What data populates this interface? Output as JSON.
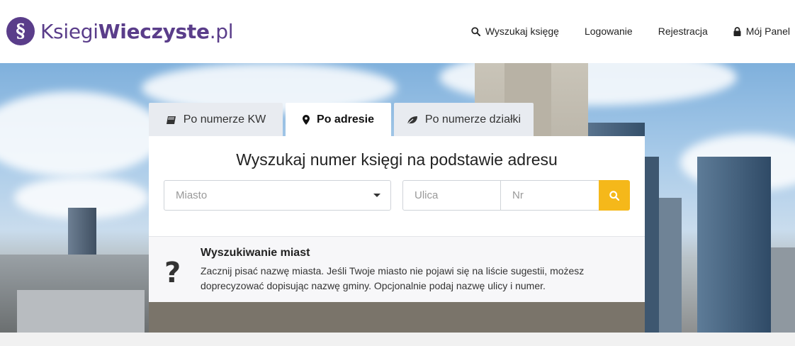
{
  "logo": {
    "badge": "§",
    "part1": "Ksiegi",
    "part2": "Wieczyste",
    "part3": ".pl"
  },
  "nav": {
    "search": "Wyszukaj księgę",
    "login": "Logowanie",
    "register": "Rejestracja",
    "panel": "Mój Panel"
  },
  "tabs": [
    {
      "label": "Po numerze KW",
      "icon": "book-icon"
    },
    {
      "label": "Po adresie",
      "icon": "map-marker-icon"
    },
    {
      "label": "Po numerze działki",
      "icon": "leaf-icon"
    }
  ],
  "search": {
    "title": "Wyszukaj numer księgi na podstawie adresu",
    "city_placeholder": "Miasto",
    "street_placeholder": "Ulica",
    "number_placeholder": "Nr"
  },
  "info": {
    "icon": "?",
    "title": "Wyszukiwanie miast",
    "line1": "Zacznij pisać nazwę miasta. Jeśli Twoje miasto nie pojawi się na liście sugestii, możesz",
    "line2": "doprecyzować dopisując nazwę gminy. Opcjonalnie podaj nazwę ulicy i numer."
  },
  "colors": {
    "brand": "#5a3d8a",
    "accent": "#f5b81a"
  }
}
